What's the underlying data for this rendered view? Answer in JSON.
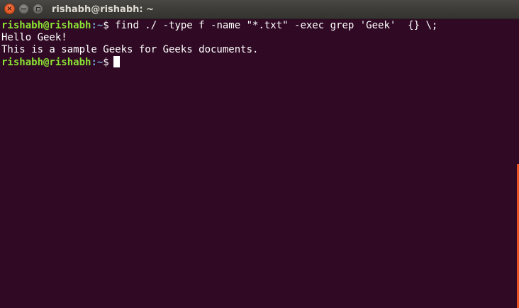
{
  "window": {
    "title": "rishabh@rishabh: ~",
    "controls": {
      "close_glyph": "×",
      "minimize_glyph": "−"
    }
  },
  "terminal": {
    "command_line": {
      "user_host": "rishabh@rishabh",
      "path": ":~",
      "symbol": "$",
      "command": " find ./ -type f -name \"*.txt\" -exec grep 'Geek'  {} \\;"
    },
    "output": [
      "Hello Geek!",
      "This is a sample Geeks for Geeks documents."
    ],
    "current_prompt": {
      "user_host": "rishabh@rishabh",
      "path": ":~",
      "symbol": "$"
    }
  },
  "colors": {
    "background": "#300a24",
    "prompt_user": "#8ae234",
    "prompt_path": "#729fcf",
    "text": "#ffffff",
    "scrollbar_thumb": "#e95420",
    "close_button": "#e2541f"
  },
  "icons": {
    "close": "close-icon",
    "minimize": "minimize-icon",
    "maximize": "maximize-icon"
  },
  "scroll": {
    "thumb_fraction": 0.5,
    "thumb_start_fraction": 0.5
  }
}
